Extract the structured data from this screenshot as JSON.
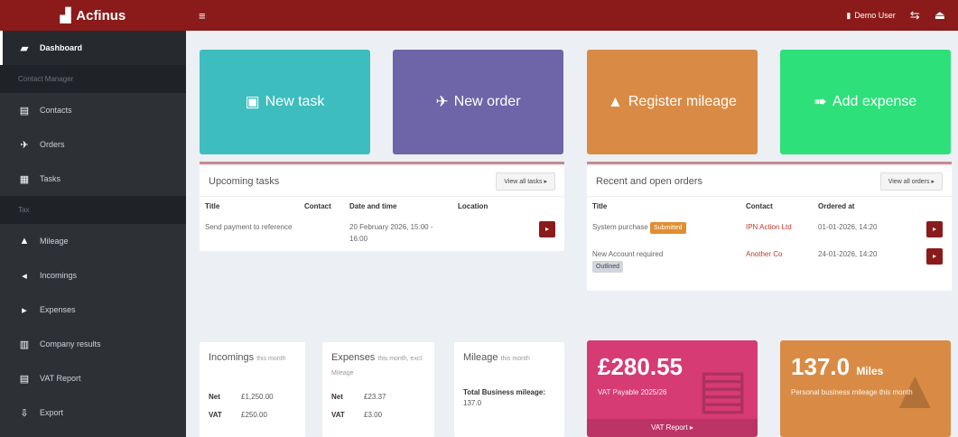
{
  "app": {
    "brand": "Acfinus",
    "brand_icon": "building-icon"
  },
  "topbar": {
    "toggle_icon": "≡",
    "user_name": "Demo User",
    "share_icon": "⇆",
    "exit_icon": "⏏"
  },
  "sidebar": {
    "items": [
      {
        "label": "Dashboard",
        "icon": "▰"
      },
      {
        "label": "Contact Manager",
        "header": true
      },
      {
        "label": "Contacts",
        "icon": "▤"
      },
      {
        "label": "Orders",
        "icon": "✈"
      },
      {
        "label": "Tasks",
        "icon": "▦"
      },
      {
        "label": "Tax",
        "header": true
      },
      {
        "label": "Mileage",
        "icon": "▲"
      },
      {
        "label": "Incomings",
        "icon": "◂"
      },
      {
        "label": "Expenses",
        "icon": "▸"
      },
      {
        "label": "Company results",
        "icon": "▥"
      },
      {
        "label": "VAT Report",
        "icon": "▤"
      },
      {
        "label": "Export",
        "icon": "⇩"
      }
    ]
  },
  "tiles": {
    "new_task": {
      "label": "New task",
      "icon": "▣",
      "color": "#3dbdbd"
    },
    "new_order": {
      "label": "New order",
      "icon": "✈",
      "color": "#6e64a8"
    },
    "register_mileage": {
      "label": "Register mileage",
      "icon": "▲",
      "color": "#d98b45"
    },
    "add_expense": {
      "label": "Add expense",
      "icon": "➠",
      "color": "#2ee07a"
    }
  },
  "upcoming": {
    "title": "Upcoming tasks",
    "view_all": "View all tasks ▸",
    "headers": [
      "Title",
      "Contact",
      "Date and time",
      "Location"
    ],
    "rows": [
      {
        "title": "Send payment to reference",
        "contact": "",
        "datetime": "20 February 2026, 15:00 - 16:00",
        "location": ""
      }
    ]
  },
  "orders": {
    "title": "Recent and open orders",
    "view_all": "View all orders ▸",
    "headers": [
      "Title",
      "Contact",
      "Ordered at"
    ],
    "rows": [
      {
        "title": "System purchase",
        "badge": "Submitted",
        "badge_type": "warn",
        "contact": "IPN Action Ltd",
        "date": "01-01-2026, 14:20"
      },
      {
        "title": "New Account required",
        "badge": "Outlined",
        "badge_type": "default",
        "contact": "Another Co",
        "date": "24-01-2026, 14:20"
      }
    ]
  },
  "incomings": {
    "title": "Incomings",
    "sub": "this month",
    "rows": [
      {
        "label": "Net",
        "value": "£1,250.00"
      },
      {
        "label": "VAT",
        "value": "£250.00"
      }
    ]
  },
  "expenses": {
    "title": "Expenses",
    "sub": "this month, excl. Mileage",
    "rows": [
      {
        "label": "Net",
        "value": "£23.37"
      },
      {
        "label": "VAT",
        "value": "£3.00"
      }
    ]
  },
  "mileage": {
    "title": "Mileage",
    "sub": "this month",
    "total_label": "Total Business mileage:",
    "total_value": "137.0"
  },
  "vat_tile": {
    "value": "£280.55",
    "sub": "VAT Payable 2025/26",
    "footer": "VAT Report ▸",
    "color": "#d63b73"
  },
  "miles_tile": {
    "value": "137.0",
    "unit": "Miles",
    "sub": "Personal business mileage this month",
    "color": "#d98b45"
  }
}
